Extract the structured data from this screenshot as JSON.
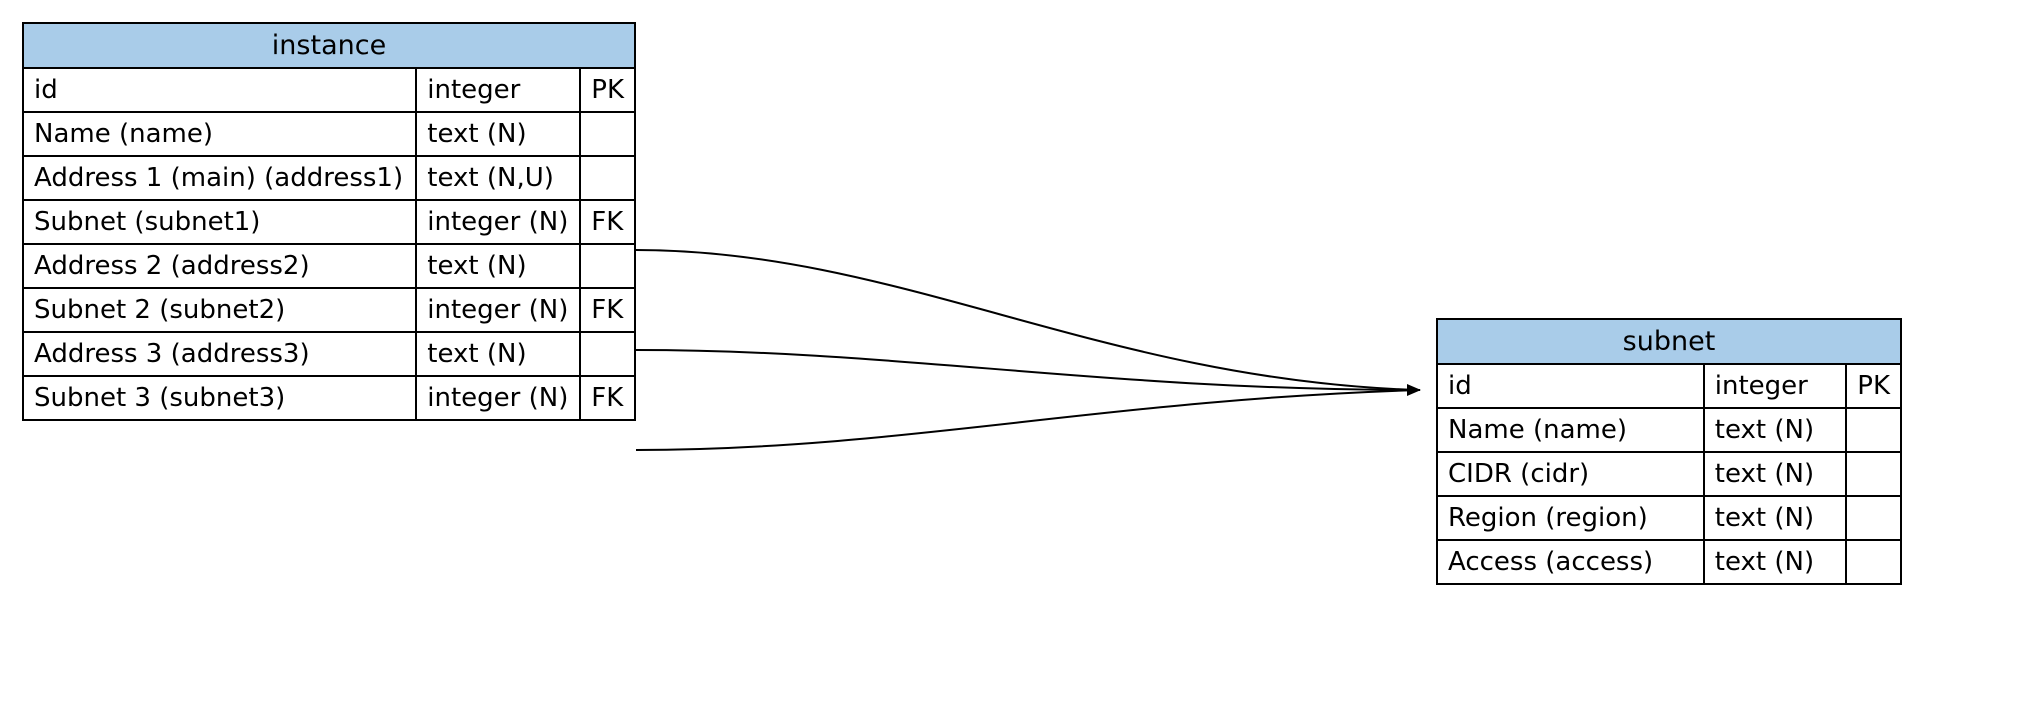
{
  "entities": {
    "instance": {
      "title": "instance",
      "rows": [
        {
          "name": "id",
          "type": "integer",
          "key": "PK"
        },
        {
          "name": "Name (name)",
          "type": "text (N)",
          "key": ""
        },
        {
          "name": "Address 1 (main) (address1)",
          "type": "text (N,U)",
          "key": ""
        },
        {
          "name": "Subnet  (subnet1)",
          "type": "integer (N)",
          "key": "FK"
        },
        {
          "name": "Address 2 (address2)",
          "type": "text (N)",
          "key": ""
        },
        {
          "name": "Subnet 2 (subnet2)",
          "type": "integer (N)",
          "key": "FK"
        },
        {
          "name": "Address 3 (address3)",
          "type": "text (N)",
          "key": ""
        },
        {
          "name": "Subnet 3 (subnet3)",
          "type": "integer (N)",
          "key": "FK"
        }
      ]
    },
    "subnet": {
      "title": "subnet",
      "rows": [
        {
          "name": "id",
          "type": "integer",
          "key": "PK"
        },
        {
          "name": "Name (name)",
          "type": "text (N)",
          "key": ""
        },
        {
          "name": "CIDR (cidr)",
          "type": "text (N)",
          "key": ""
        },
        {
          "name": "Region (region)",
          "type": "text (N)",
          "key": ""
        },
        {
          "name": "Access (access)",
          "type": "text (N)",
          "key": ""
        }
      ]
    }
  },
  "edges": [
    {
      "from": "instance.subnet1",
      "to": "subnet.id"
    },
    {
      "from": "instance.subnet2",
      "to": "subnet.id"
    },
    {
      "from": "instance.subnet3",
      "to": "subnet.id"
    }
  ]
}
